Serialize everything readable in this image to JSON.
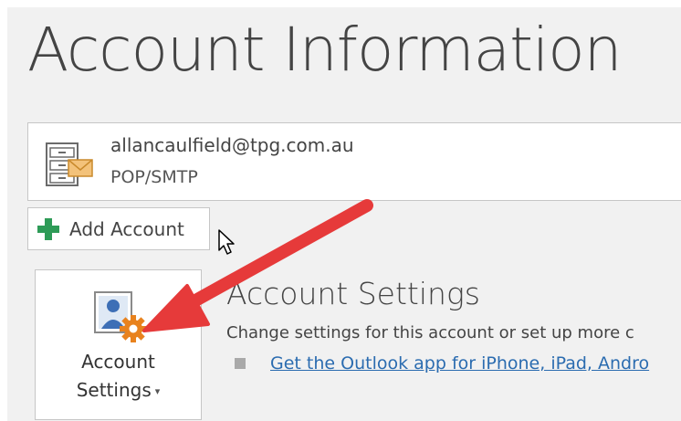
{
  "page": {
    "title": "Account Information"
  },
  "account": {
    "email": "allancaulfield@tpg.com.au",
    "type": "POP/SMTP",
    "icon": "mail-cabinet-icon"
  },
  "add_account": {
    "label": "Add Account",
    "icon": "plus-icon"
  },
  "settings_button": {
    "label_line1": "Account",
    "label_line2": "Settings",
    "caret": "▾",
    "icon": "account-settings-icon"
  },
  "account_settings": {
    "title": "Account Settings",
    "description": "Change settings for this account or set up more c",
    "link": "Get the Outlook app for iPhone, iPad, Andro"
  },
  "colors": {
    "accent_plus": "#2e9b57",
    "annotation_arrow": "#e63a3a",
    "link": "#2b6cb0",
    "gear": "#e8821e"
  }
}
